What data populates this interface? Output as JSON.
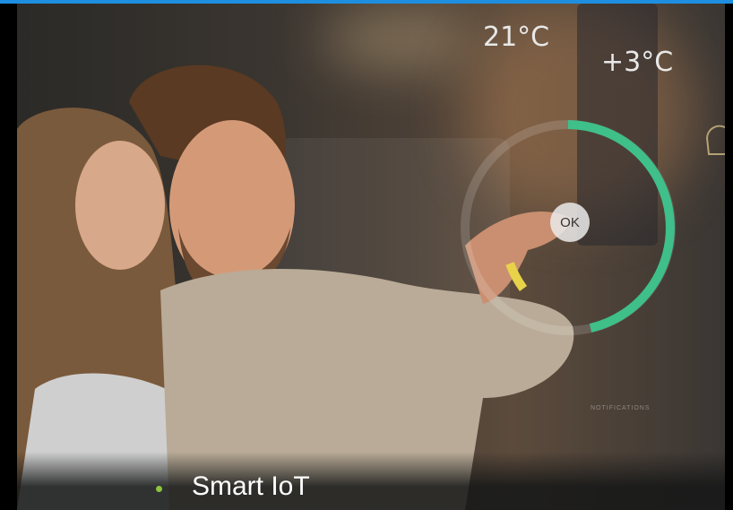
{
  "hud": {
    "indoor_temp": "21°C",
    "outdoor_temp": "+3°C",
    "ok_label": "OK",
    "notifications_label": "NOTIFICATIONS"
  },
  "caption": {
    "bullet_text": "Smart IoT",
    "bullet_color": "#8dc63f"
  },
  "colors": {
    "top_accent": "#1e8fe0",
    "ring_green": "#3fbf8a",
    "ring_yellow": "#e8d24a"
  }
}
